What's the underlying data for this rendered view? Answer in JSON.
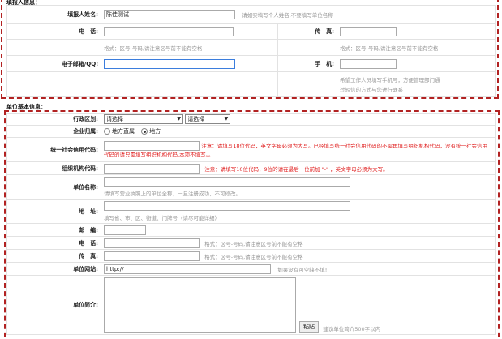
{
  "contact": {
    "section_title": "填报人信息：",
    "name_label": "填报人姓名:",
    "name_value": "陈佳测试",
    "name_hint": "请如实填写个人姓名,不要填写单位名称",
    "phone_label": "电　话:",
    "phone_hint": "格式：区号-号码,请注意区号前不能有空格",
    "fax_label": "传　真:",
    "fax_hint": "格式：区号-号码,请注意区号前不能有空格",
    "email_label": "电子邮箱/QQ:",
    "mobile_label": "手　机:",
    "mobile_hint_1": "希望工作人员填写手机号，方便管理部门通",
    "mobile_hint_2": "过短信的方式与您进行联系"
  },
  "unit": {
    "section_title": "单位基本信息：",
    "region_label": "行政区划:",
    "region_select_1": "请选择",
    "region_select_2": "请选择",
    "ownership_label": "企业归属:",
    "ownership_opt_1": "地方直属",
    "ownership_opt_2": "地方",
    "credit_label": "统一社会信用代码:",
    "credit_warn": "注意：请填写18位代码，英文字母必须为大写。已经填写统一社会信用代码的不需再填写组织机构代码，没有统一社会信用代码的请只需填写组织机构代码,本项不填写。。",
    "org_label": "组织机构代码:",
    "org_warn": "注意：请填写10位代码，9位的请在最后一位前加 \"-\" ，英文字母必须为大写。",
    "name_label": "单位名称:",
    "name_hint": "请填写营业执照上的单位全称，一旦注册成功，不可修改。",
    "address_label": "地　址:",
    "address_hint": "填写省、市、区、街道、门牌号（请尽可能详细）",
    "postcode_label": "邮　编:",
    "phone_label": "电　话:",
    "phone_hint": "格式：区号-号码,请注意区号前不能有空格",
    "fax_label": "传　真:",
    "fax_hint": "格式：区号-号码,请注意区号前不能有空格",
    "website_label": "单位网站:",
    "website_value": "http://",
    "website_hint": "如果没有可空缺不填!",
    "intro_label": "单位简介:",
    "paste_button": "粘贴",
    "intro_hint": "建议单位简介500字以内"
  },
  "colors": {
    "dash": "#b22222",
    "warn": "#e02020",
    "focus": "#3b7ddd"
  }
}
